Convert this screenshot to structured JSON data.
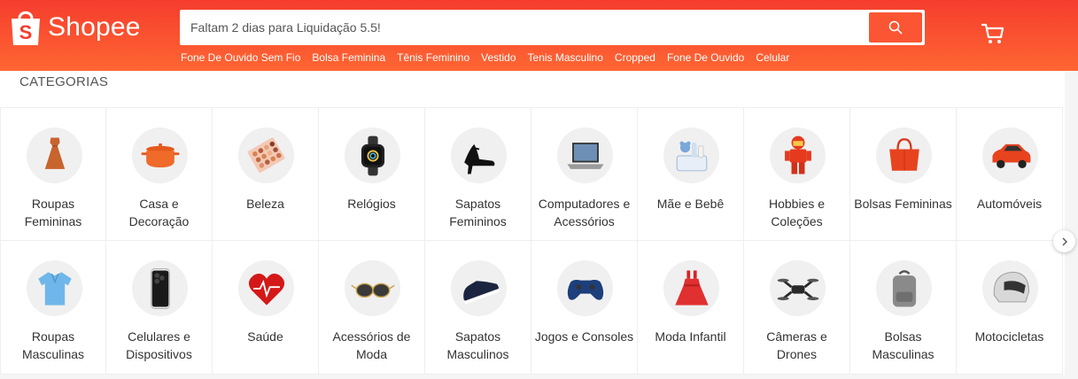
{
  "header": {
    "logo_text": "Shopee",
    "search_placeholder": "Faltam 2 dias para Liquidação 5.5!",
    "suggestions": [
      "Fone De Ouvido Sem Fio",
      "Bolsa Feminina",
      "Tênis Feminino",
      "Vestido",
      "Tenis Masculino",
      "Cropped",
      "Fone De Ouvido",
      "Celular"
    ]
  },
  "categories": {
    "title": "CATEGORIAS",
    "items": [
      {
        "label": "Roupas Femininas",
        "icon": "dress-icon"
      },
      {
        "label": "Casa e Decoração",
        "icon": "cooking-pot-icon"
      },
      {
        "label": "Beleza",
        "icon": "eyeshadow-palette-icon"
      },
      {
        "label": "Relógios",
        "icon": "smartwatch-icon"
      },
      {
        "label": "Sapatos Femininos",
        "icon": "high-heel-icon"
      },
      {
        "label": "Computadores e Acessórios",
        "icon": "laptop-icon"
      },
      {
        "label": "Mãe e Bebê",
        "icon": "baby-basket-icon"
      },
      {
        "label": "Hobbies e Coleções",
        "icon": "toy-figure-icon"
      },
      {
        "label": "Bolsas Femininas",
        "icon": "handbag-icon"
      },
      {
        "label": "Automóveis",
        "icon": "car-icon"
      },
      {
        "label": "Roupas Masculinas",
        "icon": "polo-shirt-icon"
      },
      {
        "label": "Celulares e Dispositivos",
        "icon": "smartphone-icon"
      },
      {
        "label": "Saúde",
        "icon": "heart-pulse-icon"
      },
      {
        "label": "Acessórios de Moda",
        "icon": "sunglasses-icon"
      },
      {
        "label": "Sapatos Masculinos",
        "icon": "sneaker-icon"
      },
      {
        "label": "Jogos e Consoles",
        "icon": "game-controller-icon"
      },
      {
        "label": "Moda Infantil",
        "icon": "kids-dress-icon"
      },
      {
        "label": "Câmeras e Drones",
        "icon": "drone-icon"
      },
      {
        "label": "Bolsas Masculinas",
        "icon": "backpack-icon"
      },
      {
        "label": "Motocicletas",
        "icon": "helmet-icon"
      }
    ]
  },
  "colors": {
    "brand": "#ee4d2d",
    "text": "#333333"
  }
}
